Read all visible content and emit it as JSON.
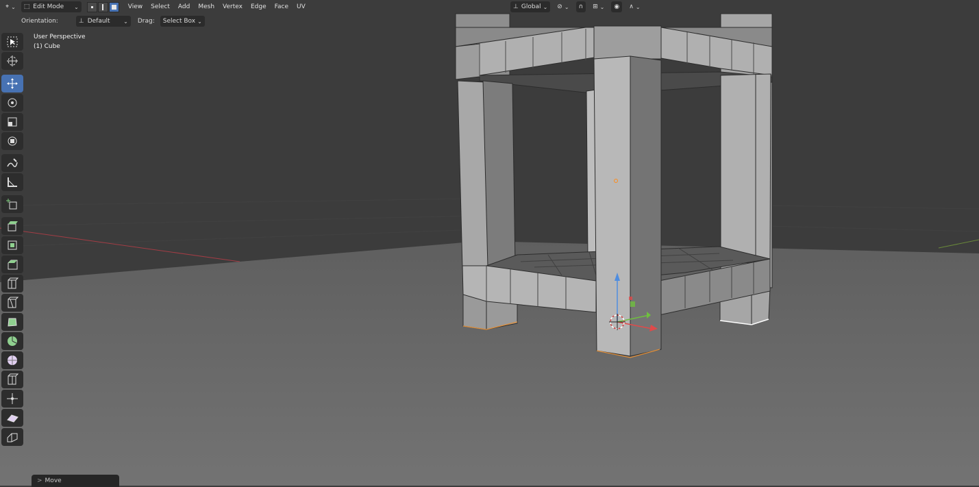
{
  "header": {
    "mode": "Edit Mode",
    "menus": [
      "View",
      "Select",
      "Add",
      "Mesh",
      "Vertex",
      "Edge",
      "Face",
      "UV"
    ],
    "transform_orientation": "Global"
  },
  "tool_settings": {
    "orientation_label": "Orientation:",
    "orientation_value": "Default",
    "drag_label": "Drag:",
    "drag_value": "Select Box"
  },
  "viewport": {
    "view_name": "User Perspective",
    "object_name": "(1) Cube"
  },
  "last_operator": {
    "label": "Move",
    "prefix": ">"
  },
  "toolbar": {
    "active_tool": "move",
    "tools": [
      "select-box",
      "cursor",
      "move",
      "rotate",
      "scale",
      "transform",
      "annotate",
      "measure",
      "add-cube",
      "extrude-region",
      "inset-faces",
      "bevel",
      "loop-cut",
      "knife",
      "poly-build",
      "spin",
      "smooth",
      "edge-slide",
      "shrink-fatten",
      "shear",
      "rip-region"
    ]
  },
  "colors": {
    "accent": "#4772b3",
    "background": "#3d3d3d",
    "ground": "#6c6c6c",
    "mesh_face": "#9c9c9c",
    "x_axis": "#e04a4a",
    "y_axis": "#6fbf3f",
    "z_axis": "#4f8de0"
  }
}
